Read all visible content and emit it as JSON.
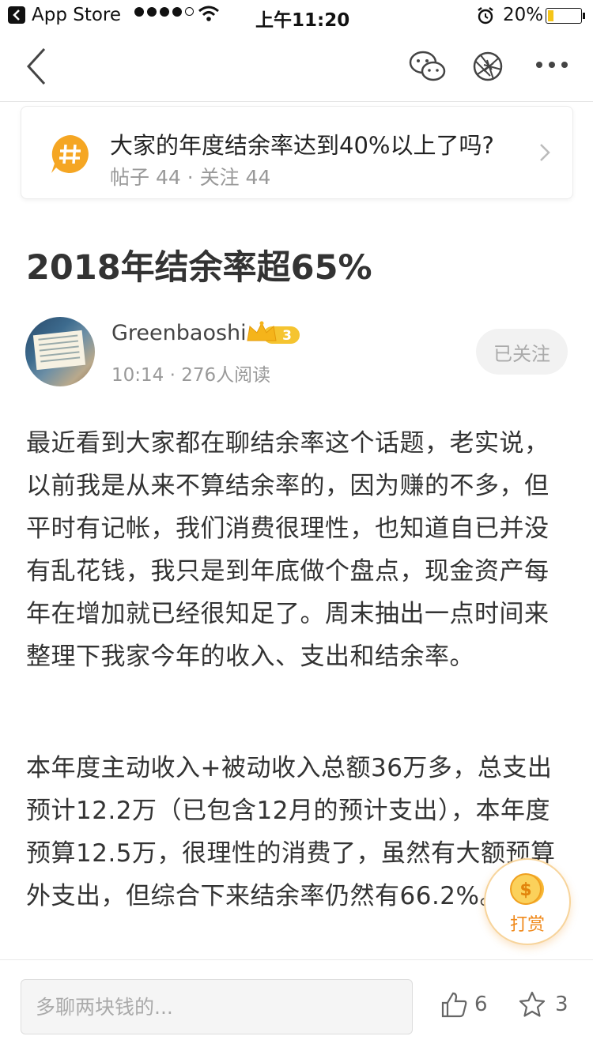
{
  "status_bar": {
    "back_app": "App Store",
    "time": "上午11:20",
    "battery": "20%",
    "battery_level": 0.2
  },
  "nav": {
    "back_icon": "chevron-left-icon",
    "share_wechat_icon": "wechat-icon",
    "moments_icon": "moments-icon",
    "more_icon": "more-icon"
  },
  "topic": {
    "title": "大家的年度结余率达到40%以上了吗?",
    "meta": "帖子 44 · 关注 44",
    "badge_icon": "hashtag-icon",
    "accent": "#f5a623"
  },
  "article": {
    "title": "2018年结余率超65%",
    "author": {
      "name": "Greenbaoshi",
      "level": "3",
      "meta": "10:14 · 276人阅读",
      "follow_label": "已关注"
    },
    "paragraphs": [
      "最近看到大家都在聊结余率这个话题，老实说，以前我是从来不算结余率的，因为赚的不多，但平时有记帐，我们消费很理性，也知道自已并没有乱花钱，我只是到年底做个盘点，现金资产每年在增加就已经很知足了。周末抽出一点时间来整理下我家今年的收入、支出和结余率。",
      "本年度主动收入+被动收入总额36万多，总支出预计12.2万（已包含12月的预计支出），本年度预算12.5万，很理性的消费了，虽然有大额预算外支出，但综合下来结余率仍然有66.2%。"
    ]
  },
  "reward": {
    "label": "打赏",
    "icon": "coin-icon"
  },
  "bottom_bar": {
    "comment_placeholder": "多聊两块钱的...",
    "like_count": "6",
    "favorite_count": "3"
  }
}
